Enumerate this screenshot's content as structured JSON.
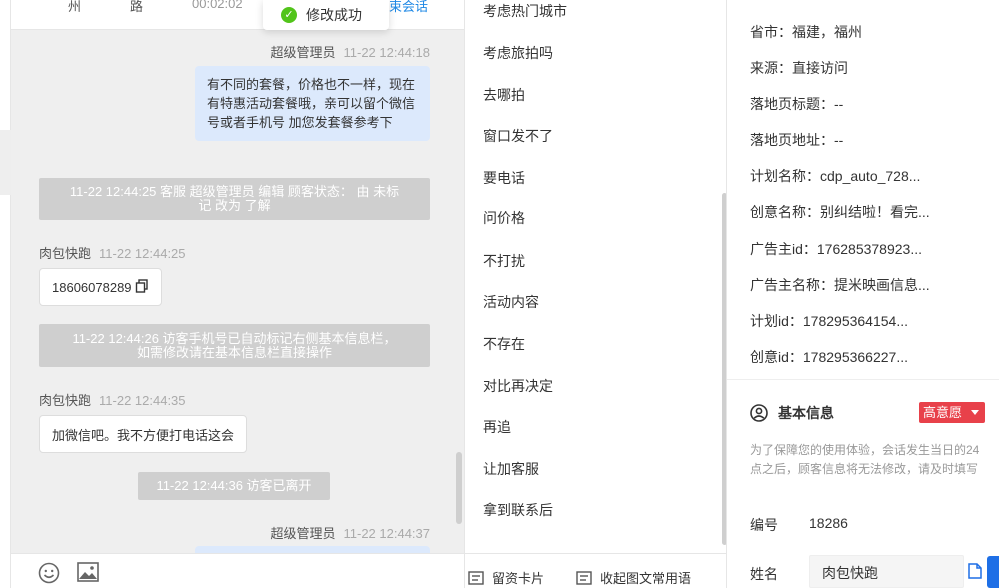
{
  "chat_header": {
    "city": "州",
    "road": "路",
    "duration": "00:02:02",
    "link": "束会话"
  },
  "toast": {
    "text": "修改成功"
  },
  "messages": {
    "m1_sender": "超级管理员",
    "m1_time": "11-22 12:44:18",
    "m1_text": "有不同的套餐，价格也不一样，现在有特惠活动套餐哦，亲可以留个微信号或者手机号 加您发套餐参考下",
    "sys1_line1": "11-22 12:44:25 客服 超级管理员 编辑 顾客状态： 由 未标",
    "sys1_line2": "记 改为 了解",
    "m2_sender": "肉包快跑",
    "m2_time": "11-22 12:44:25",
    "m2_text": "18606078289",
    "sys2_line1": "11-22 12:44:26 访客手机号已自动标记右侧基本信息栏，",
    "sys2_line2": "如需修改请在基本信息栏直接操作",
    "m3_sender": "肉包快跑",
    "m3_time": "11-22 12:44:35",
    "m3_text": "加微信吧。我不方便打电话这会",
    "sys3": "11-22 12:44:36 访客已离开",
    "m4_sender": "超级管理员",
    "m4_time": "11-22 12:44:37"
  },
  "quick_replies": [
    "考虑热门城市",
    "考虑旅拍吗",
    "去哪拍",
    "窗口发不了",
    "要电话",
    "问价格",
    "不打扰",
    "活动内容",
    "不存在",
    "对比再决定",
    "再追",
    "让加客服",
    "拿到联系后"
  ],
  "quick_bottom": {
    "leave_card": "留资卡片",
    "collapse": "收起图文常用语"
  },
  "info": {
    "province": "省市：福建，福州",
    "source": "来源：直接访问",
    "landing_title": "落地页标题：--",
    "landing_url": "落地页地址：--",
    "plan_name": "计划名称：cdp_auto_728...",
    "creative_name": "创意名称：别纠结啦！看完...",
    "advertiser_id": "广告主id：176285378923...",
    "advertiser_name": "广告主名称：提米映画信息...",
    "plan_id": "计划id：178295364154...",
    "creative_id": "创意id：178295366227...",
    "section_title": "基本信息",
    "intent": "高意愿",
    "notice": "为了保障您的使用体验，会话发生当日的24点之后，顾客信息将无法修改，请及时填写",
    "number_label": "编号",
    "number_value": "18286",
    "name_label": "姓名",
    "name_value": "肉包快跑"
  },
  "colors": {
    "accent_blue": "#1e6fe6",
    "intent_red": "#e8414a",
    "agent_bubble": "#dce9fc",
    "success_green": "#52c41a"
  }
}
